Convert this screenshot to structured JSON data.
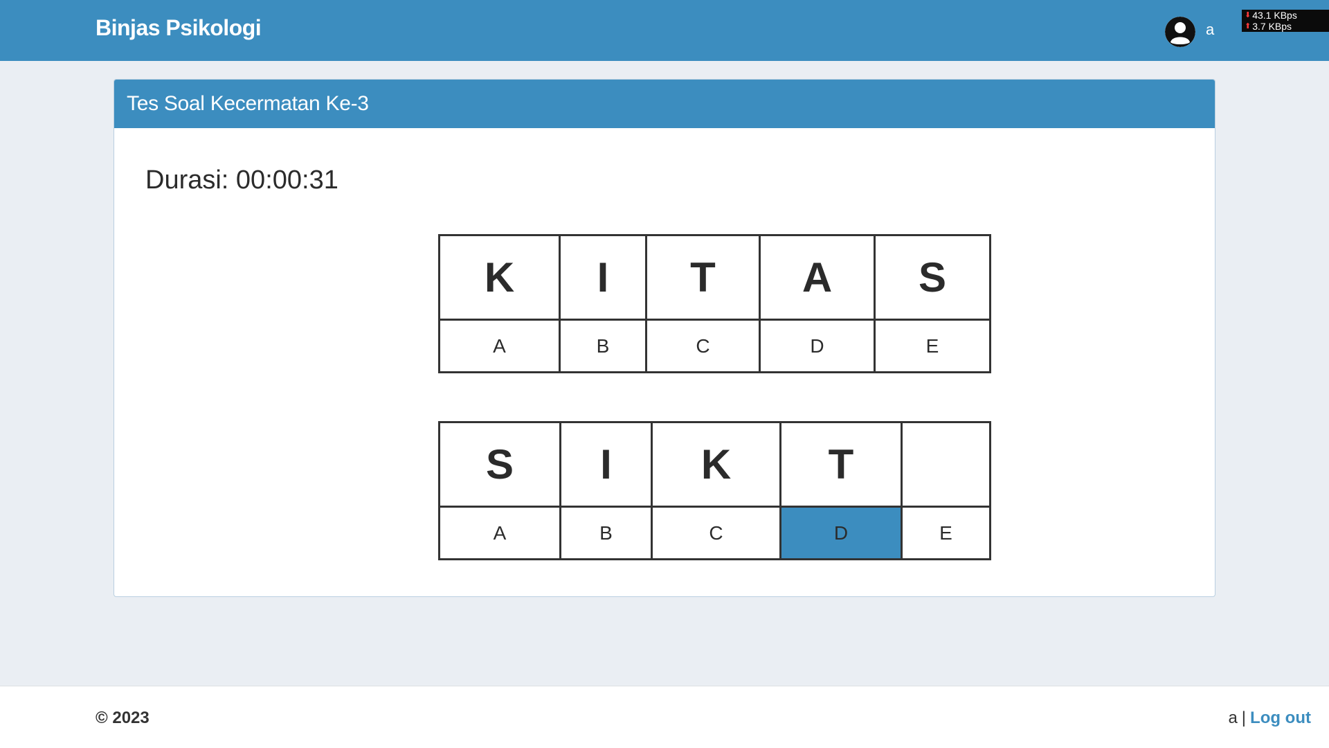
{
  "navbar": {
    "brand": "Binjas Psikologi",
    "user_name": "a",
    "net_download": "43.1 KBps",
    "net_upload": "3.7 KBps"
  },
  "card": {
    "title": "Tes Soal Kecermatan Ke-3",
    "duration": "Durasi: 00:00:31"
  },
  "question_key": {
    "letters": [
      "K",
      "I",
      "T",
      "A",
      "S"
    ],
    "options": [
      "A",
      "B",
      "C",
      "D",
      "E"
    ]
  },
  "question": {
    "letters": [
      "S",
      "I",
      "K",
      "T",
      ""
    ],
    "options": [
      "A",
      "B",
      "C",
      "D",
      "E"
    ],
    "selected_option": "D"
  },
  "footer": {
    "copyright": "© 2023",
    "user_name": "a",
    "separator": "|",
    "logout_label": "Log out"
  },
  "colors": {
    "primary": "#3c8dbf",
    "background": "#eaeef3"
  }
}
